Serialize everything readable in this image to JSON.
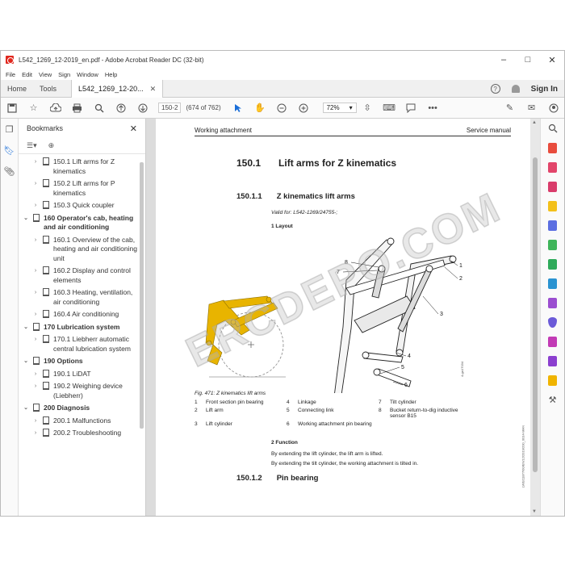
{
  "window": {
    "title": "L542_1269_12-2019_en.pdf - Adobe Acrobat Reader DC (32-bit)",
    "controls": [
      "–",
      "□",
      "✕"
    ]
  },
  "menu": [
    "File",
    "Edit",
    "View",
    "Sign",
    "Window",
    "Help"
  ],
  "tabs": {
    "home": "Home",
    "tools": "Tools",
    "doc": "L542_1269_12-20..."
  },
  "signin": "Sign In",
  "help_glyph": "?",
  "toolbar": {
    "page_current": "150-2",
    "page_of": "(674 of 762)",
    "zoom": "72%"
  },
  "bookmarks": {
    "title": "Bookmarks",
    "items": [
      {
        "level": 1,
        "label": "150.1 Lift arms for Z kinematics"
      },
      {
        "level": 1,
        "label": "150.2 Lift arms for P kinematics"
      },
      {
        "level": 1,
        "label": "150.3 Quick coupler"
      },
      {
        "level": 0,
        "label": "160 Operator's cab, heating and air conditioning",
        "expanded": true
      },
      {
        "level": 1,
        "label": "160.1 Overview of the cab, heating and air conditioning unit"
      },
      {
        "level": 1,
        "label": "160.2 Display and control elements"
      },
      {
        "level": 1,
        "label": "160.3 Heating, ventilation, air conditioning"
      },
      {
        "level": 1,
        "label": "160.4 Air conditioning"
      },
      {
        "level": 0,
        "label": "170 Lubrication system",
        "expanded": true
      },
      {
        "level": 1,
        "label": "170.1 Liebherr automatic central lubrication system"
      },
      {
        "level": 0,
        "label": "190 Options",
        "expanded": true
      },
      {
        "level": 1,
        "label": "190.1 LiDAT"
      },
      {
        "level": 1,
        "label": "190.2 Weighing device (Liebherr)"
      },
      {
        "level": 0,
        "label": "200 Diagnosis",
        "expanded": true
      },
      {
        "level": 1,
        "label": "200.1 Malfunctions"
      },
      {
        "level": 1,
        "label": "200.2 Troubleshooting"
      }
    ]
  },
  "page": {
    "header_left": "Working attachment",
    "header_right": "Service manual",
    "h1_num": "150.1",
    "h1_text": "Lift arms for Z kinematics",
    "h2_num": "150.1.1",
    "h2_text": "Z kinematics lift arms",
    "valid": "Valid for: L542-1269/24755-;",
    "layout": "1 Layout",
    "fig_caption": "Fig. 471: Z kinematics lift arms",
    "figure_code": "4-ga17034",
    "callouts": [
      "1",
      "2",
      "3",
      "4",
      "5",
      "6",
      "7",
      "8"
    ],
    "legend": [
      [
        "1",
        "Front section pin bearing",
        "4",
        "Linkage",
        "7",
        "Tilt cylinder"
      ],
      [
        "2",
        "Lift arm",
        "5",
        "Connecting link",
        "8",
        "Bucket return-to-dig inductive sensor B15"
      ],
      [
        "3",
        "Lift cylinder",
        "6",
        "Working attachment pin bearing",
        "",
        ""
      ]
    ],
    "func_heading": "2 Function",
    "func_text1": "By extending the lift cylinder, the lift arm is lifted.",
    "func_text2": "By extending the tilt cylinder, the working attachment is tilted in.",
    "h3_num": "150.1.2",
    "h3_text": "Pin bearing",
    "side_code": "LWE/11877/00/EN/12/2019/200_0014-MAN",
    "watermark": "ERCDEPO.COM"
  },
  "colors": {
    "accent_yellow": "#e8b400",
    "doc_bg": "#dcdcdc",
    "acrobat_red": "#e0281e"
  }
}
